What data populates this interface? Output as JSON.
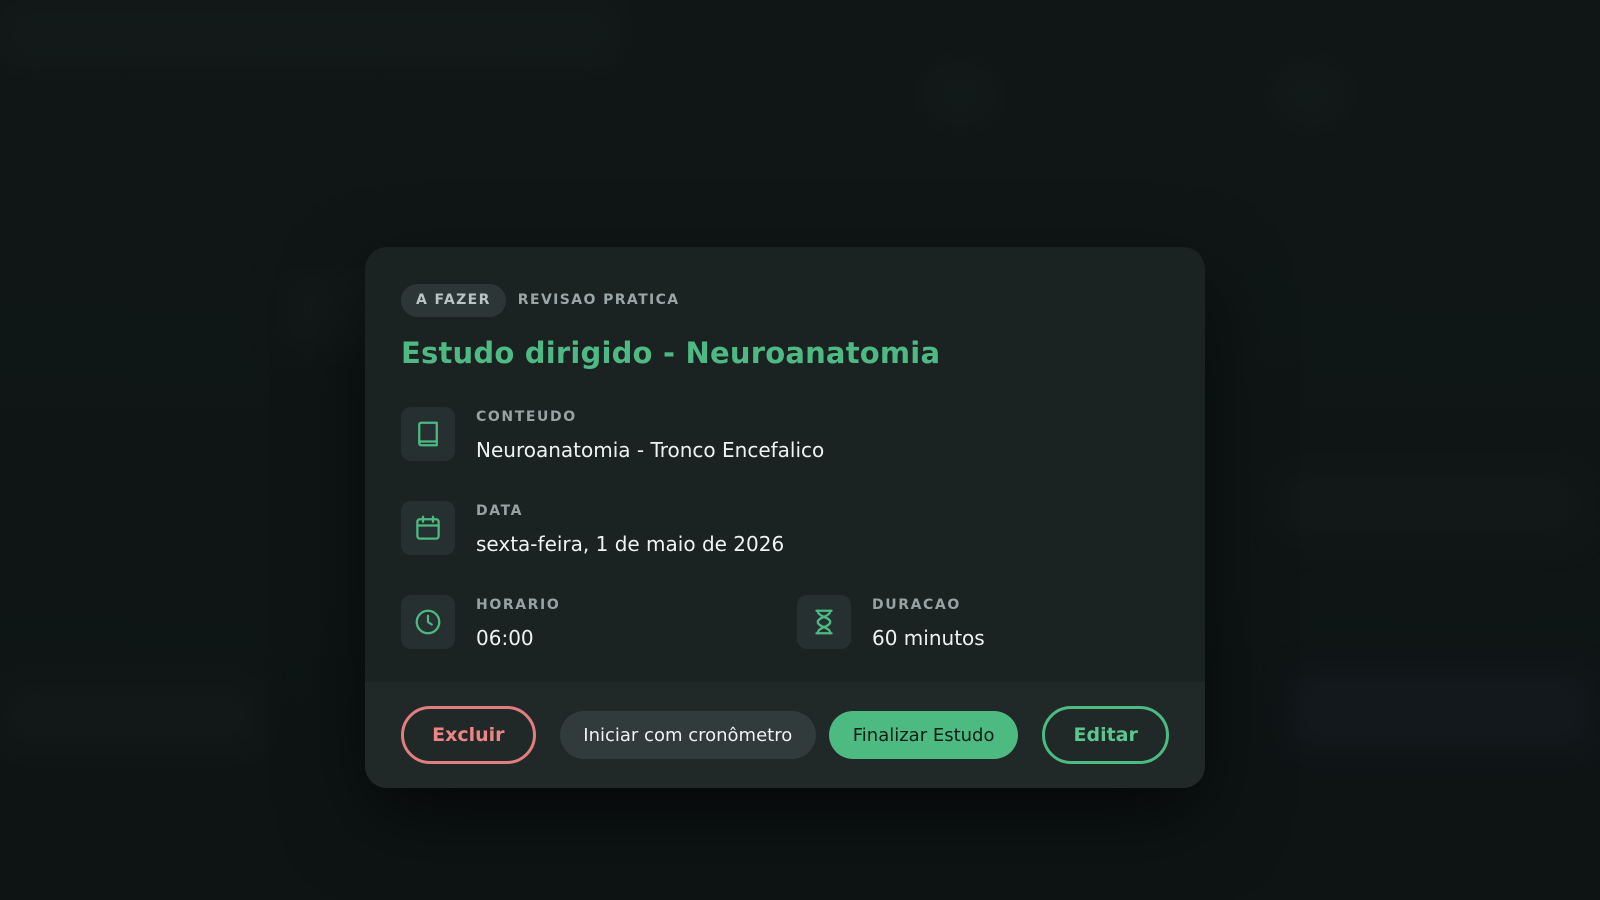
{
  "modal": {
    "status": "A FAZER",
    "type": "REVISAO PRATICA",
    "title": "Estudo dirigido - Neuroanatomia",
    "content": {
      "label": "CONTEUDO",
      "value": "Neuroanatomia - Tronco Encefalico",
      "icon": "book-icon"
    },
    "date": {
      "label": "DATA",
      "value": "sexta-feira, 1 de maio de 2026",
      "icon": "calendar-icon"
    },
    "time": {
      "label": "HORARIO",
      "value": "06:00",
      "icon": "clock-icon"
    },
    "duration": {
      "label": "DURACAO",
      "value": "60 minutos",
      "icon": "hourglass-icon"
    },
    "actions": {
      "delete_label": "Excluir",
      "timer_label": "Iniciar com cronômetro",
      "finish_label": "Finalizar Estudo",
      "edit_label": "Editar"
    }
  },
  "colors": {
    "accent": "#4dba82",
    "danger": "#e07f7f",
    "modal_bg": "#1b2222",
    "footer_bg": "#202828"
  }
}
